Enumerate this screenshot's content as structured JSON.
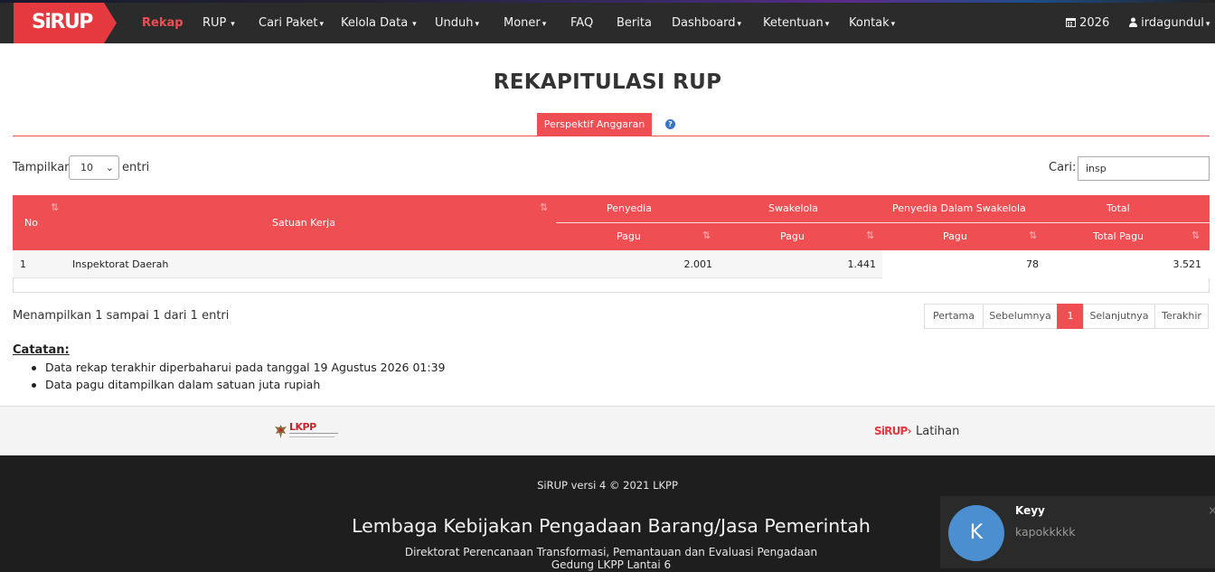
{
  "nav": {
    "brand": "SiRUP",
    "items": [
      {
        "label": "Rekap",
        "caret": false,
        "active": true
      },
      {
        "label": "RUP",
        "caret": true
      },
      {
        "label": "Cari Paket",
        "caret": true
      },
      {
        "label": "Kelola Data",
        "caret": true
      },
      {
        "label": "Unduh",
        "caret": true
      },
      {
        "label": "Moner",
        "caret": true
      },
      {
        "label": "FAQ",
        "caret": false
      },
      {
        "label": "Berita",
        "caret": false
      },
      {
        "label": "Dashboard",
        "caret": true
      },
      {
        "label": "Ketentuan",
        "caret": true
      },
      {
        "label": "Kontak",
        "caret": true
      }
    ],
    "year": "2026",
    "user": "irdagundul"
  },
  "page": {
    "title": "REKAPITULASI RUP",
    "tab": "Perspektif Anggaran",
    "help": "?"
  },
  "controls": {
    "show_label": "Tampilkan",
    "show_value": "10",
    "show_after": "entri",
    "search_label": "Cari:",
    "search_value": "insp"
  },
  "table": {
    "headers": {
      "no": "No",
      "satker": "Satuan Kerja",
      "penyedia": "Penyedia",
      "swakelola": "Swakelola",
      "pds": "Penyedia Dalam Swakelola",
      "total": "Total",
      "pagu": "Pagu",
      "total_pagu": "Total Pagu"
    },
    "rows": [
      {
        "no": "1",
        "satker": "Inspektorat Daerah",
        "penyedia": "2.001",
        "swakelola": "1.441",
        "pds": "78",
        "total": "3.521"
      }
    ]
  },
  "info": "Menampilkan 1 sampai 1 dari 1 entri",
  "pagination": {
    "first": "Pertama",
    "prev": "Sebelumnya",
    "current": "1",
    "next": "Selanjutnya",
    "last": "Terakhir"
  },
  "notes": {
    "title": "Catatan:",
    "items": [
      "Data rekap terakhir diperbaharui pada tanggal 19 Agustus 2026 01:39",
      "Data pagu ditampilkan dalam satuan juta rupiah"
    ]
  },
  "footer": {
    "lkpp": "LKPP",
    "sirup_logo": "SiRUP",
    "latihan": "Latihan",
    "version": "SiRUP versi 4 © 2021 LKPP",
    "org": "Lembaga Kebijakan Pengadaan Barang/Jasa Pemerintah",
    "directorate": "Direktorat Perencanaan Transformasi, Pemantauan dan Evaluasi Pengadaan",
    "address": "Gedung LKPP Lantai 6"
  },
  "chat": {
    "avatar_letter": "K",
    "name": "Keyy",
    "message": "kapokkkkk",
    "close": "×"
  }
}
